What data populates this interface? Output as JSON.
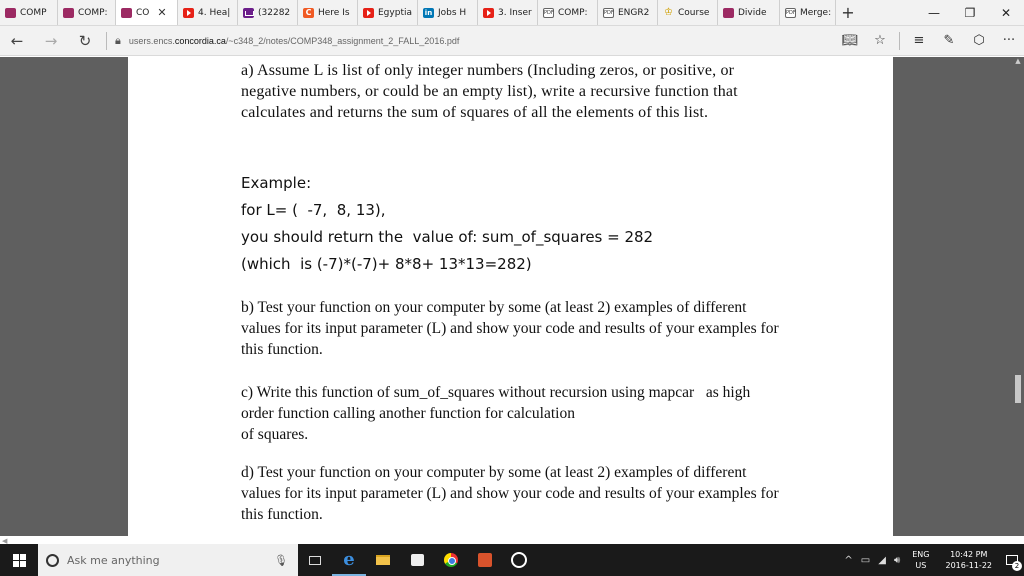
{
  "tabs": [
    {
      "label": "COMP",
      "icon": "concordia-icon",
      "active": false
    },
    {
      "label": "COMP:",
      "icon": "concordia-icon",
      "active": false
    },
    {
      "label": "CO",
      "icon": "concordia-icon",
      "active": true
    },
    {
      "label": "4. Hea|",
      "icon": "youtube-icon",
      "active": false
    },
    {
      "label": "(32282",
      "icon": "mail-icon",
      "active": false
    },
    {
      "label": "Here Is",
      "icon": "c-icon",
      "active": false
    },
    {
      "label": "Egyptia",
      "icon": "youtube-icon",
      "active": false
    },
    {
      "label": "Jobs H",
      "icon": "linkedin-icon",
      "active": false
    },
    {
      "label": "3. Inser",
      "icon": "youtube-icon",
      "active": false
    },
    {
      "label": "COMP:",
      "icon": "pdf-icon",
      "active": false
    },
    {
      "label": "ENGR2",
      "icon": "pdf-icon",
      "active": false
    },
    {
      "label": "Course",
      "icon": "course-icon",
      "active": false
    },
    {
      "label": "Divide",
      "icon": "concordia-icon",
      "active": false
    },
    {
      "label": "Merge:",
      "icon": "pdf-icon",
      "active": false
    }
  ],
  "address": {
    "url_prefix": "users.encs.",
    "url_host": "concordia.ca",
    "url_path": "/~c348_2/notes/COMP348_assignment_2_FALL_2016.pdf"
  },
  "document": {
    "part_a": "a) Assume L is list of only integer numbers (Including zeros, or positive, or negative numbers, or could be an empty list), write a recursive function that calculates and returns the sum of squares of all the elements of this list.",
    "example_title": "Example:",
    "example_line1": "for L= (  -7,  8, 13),",
    "example_line2": "you should return the  value of: sum_of_squares = 282",
    "example_line3": "(which  is (-7)*(-7)+ 8*8+ 13*13=282)",
    "part_b": "b) Test your function on your computer by some (at least 2) examples of different values for its input parameter (L) and show your code and results of your examples for this function.",
    "part_c_line1": "c) Write this function of sum_of_squares without recursion using mapcar   as high",
    "part_c_line2": "order function calling another function for calculation",
    "part_c_line3": "of squares.",
    "part_d": "d) Test your function on your computer by some (at least 2) examples of different values for its input parameter (L) and show your code and results of your examples for this function."
  },
  "taskbar": {
    "search_placeholder": "Ask me anything",
    "lang_line1": "ENG",
    "lang_line2": "US",
    "time": "10:42 PM",
    "date": "2016-11-22",
    "notification_count": "2"
  },
  "colors": {
    "viewer_background": "#5f5f5f",
    "taskbar": "#1a1a1a",
    "concordia": "#9c2a63"
  }
}
